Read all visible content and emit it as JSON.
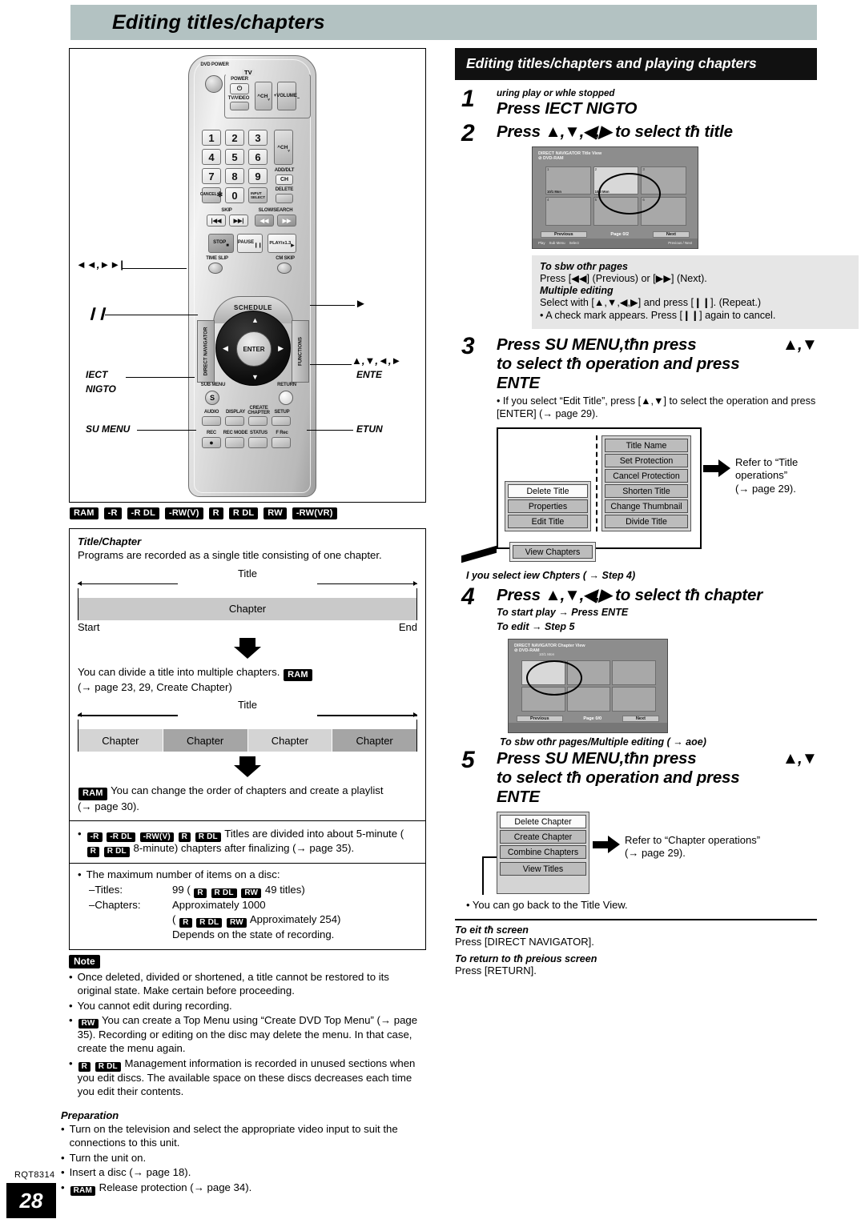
{
  "page_header": {
    "title": "Editing titles/chapters"
  },
  "footer": {
    "rqt": "RQT8314",
    "page_number": "28"
  },
  "left": {
    "remote": {
      "labels": {
        "dvd_power": "DVD POWER",
        "tv_group": "TV",
        "tv_power": "POWER",
        "tv_video": "TV/VIDEO",
        "ch": "CH",
        "volume": "VOLUME",
        "keys": [
          "1",
          "2",
          "3",
          "4",
          "5",
          "6",
          "7",
          "8",
          "9",
          "0"
        ],
        "cancel": "CANCEL",
        "cancel_glyph": "✻",
        "input_select": "INPUT SELECT",
        "add_dlt": "ADD/DLT",
        "add_dlt_ch": "CH",
        "delete": "DELETE",
        "skip": "SKIP",
        "slow_search": "SLOW/SEARCH",
        "stop": "STOP",
        "pause": "PAUSE",
        "play": "PLAY/x1.3",
        "time_slip": "TIME SLIP",
        "cm_skip": "CM SKIP",
        "schedule": "SCHEDULE",
        "direct_navigator": "DIRECT NAVIGATOR",
        "functions": "FUNCTIONS",
        "enter": "ENTER",
        "sub_menu": "SUB MENU",
        "sub_menu_glyph": "S",
        "return": "RETURN",
        "audio": "AUDIO",
        "display": "DISPLAY",
        "create_chapter": "CREATE CHAPTER",
        "setup": "SETUP",
        "rec": "REC",
        "rec_mode": "REC MODE",
        "status": "STATUS",
        "f_rec": "F Rec"
      },
      "callouts": {
        "skip_keys": "◄◄,►►|",
        "pause_key": "❙❙",
        "direct_nav_1": "IECT",
        "direct_nav_2": "NIGTO",
        "sub_menu": "SU MENU",
        "play_key": "►",
        "cursor_keys": "▲,▼,◄,►",
        "enter": "ENTE",
        "return": "ETUN"
      }
    },
    "disc_badges": [
      "RAM",
      "-R",
      "-R DL",
      "-RW(V)",
      "R",
      "R DL",
      "RW",
      "-RW(VR)"
    ],
    "title_chapter": {
      "heading": "Title/Chapter",
      "intro": "Programs are recorded as a single title consisting of one chapter.",
      "diagram1": {
        "title_label": "Title",
        "chapters": [
          "Chapter"
        ],
        "start": "Start",
        "end": "End"
      },
      "divide_text": "You can divide a title into multiple chapters.",
      "divide_badge": "RAM",
      "divide_ref": "(→ page 23, 29, Create Chapter)",
      "diagram2": {
        "title_label": "Title",
        "chapters": [
          "Chapter",
          "Chapter",
          "Chapter",
          "Chapter"
        ]
      },
      "playlist_badge": "RAM",
      "playlist_text": "You can change the order of chapters and create a playlist",
      "playlist_ref": "(→ page 30).",
      "finalize": {
        "badges": [
          "-R",
          "-R DL",
          "-RW(V)",
          "R",
          "R DL"
        ],
        "text_a": "Titles are divided into about 5-minute (",
        "badges_b": [
          "R",
          "R DL"
        ],
        "text_b": "8-minute) chapters after finalizing (→ page 35)."
      },
      "max_items": {
        "lead": "The maximum number of items on a disc:",
        "titles_key": "–Titles:",
        "titles_value_pre": "99 (",
        "titles_badges": [
          "R",
          "R DL",
          "RW"
        ],
        "titles_value_post": "49 titles)",
        "chapters_key": "–Chapters:",
        "chapters_value": "Approximately 1000",
        "chapters_badges": [
          "R",
          "R DL",
          "RW"
        ],
        "chapters_value2_pre": "(",
        "chapters_value2_post": "Approximately 254)",
        "depends": "Depends on the state of recording."
      }
    },
    "note": {
      "tag": "Note",
      "items": [
        {
          "badges": [],
          "text": "Once deleted, divided or shortened, a title cannot be restored to its original state. Make certain before proceeding."
        },
        {
          "badges": [],
          "text": "You cannot edit during recording."
        },
        {
          "badges": [
            "RW"
          ],
          "text": "You can create a Top Menu using “Create DVD Top Menu” (→ page 35). Recording or editing on the disc may delete the menu. In that case, create the menu again."
        },
        {
          "badges": [
            "R",
            "R DL"
          ],
          "text": "Management information is recorded in unused sections when you edit discs. The available space on these discs decreases each time you edit their contents."
        }
      ]
    },
    "preparation": {
      "heading": "Preparation",
      "items": [
        {
          "badges": [],
          "text": "Turn on the television and select the appropriate video input to suit the connections to this unit."
        },
        {
          "badges": [],
          "text": "Turn the unit on."
        },
        {
          "badges": [],
          "text": "Insert a disc (→ page 18)."
        },
        {
          "badges": [
            "RAM"
          ],
          "text": "Release protection (→ page 34)."
        }
      ]
    }
  },
  "right": {
    "banner": "Editing titles/chapters and playing chapters",
    "steps": [
      {
        "num": "1",
        "pre": "uring play or whle stopped",
        "headline": "Press IECT NIGTO"
      },
      {
        "num": "2",
        "headline_pre": "Press",
        "keys": "▲,▼,◀,▶",
        "headline_post": "to select tħ title"
      },
      {
        "num": "3",
        "headline_l1_a": "Press SU MENU,tħn press",
        "headline_l1_keys": "▲,▼",
        "headline_l2": "to select tħ operation and press",
        "headline_l3": "ENTE",
        "note": "If you select “Edit Title”, press [▲,▼] to select the operation and press [ENTER] (→ page 29)."
      },
      {
        "num": "4",
        "headline_pre": "Press",
        "keys": "▲,▼,◀,▶",
        "headline_post": "to select tħ chapter",
        "sub1": "To start play → Press ENTE",
        "sub2": "To edit → Step 5"
      },
      {
        "num": "5",
        "headline_l1_a": "Press SU MENU,tħn press",
        "headline_l1_keys": "▲,▼",
        "headline_l2": "to select tħ operation and press",
        "headline_l3": "ENTE"
      }
    ],
    "title_view_screen": {
      "header_line1": "DIRECT NAVIGATOR Title View",
      "header_line2": "DVD-RAM",
      "thumbs": [
        {
          "n": "1",
          "cap": "10/1 Mon",
          "cap2": "1CH 10:00"
        },
        {
          "n": "2",
          "cap": "10/3 Mon",
          "active": true
        },
        {
          "n": "3",
          "cap": ""
        },
        {
          "n": "4",
          "cap": ""
        },
        {
          "n": "5",
          "cap": ""
        },
        {
          "n": "6",
          "cap": ""
        }
      ],
      "previous": "Previous",
      "page_label": "Page",
      "page_value": "0/2",
      "next": "Next",
      "foot_play": "Play",
      "foot_submenu": "Sub Menu",
      "foot_select": "Select",
      "foot_prevnext": "Previous / Next"
    },
    "chapter_view_screen": {
      "header_line1": "DIRECT NAVIGATOR Chapter View",
      "header_line2": "DVD-RAM",
      "title_caption": "10/1 Mon",
      "previous": "Previous",
      "page_label": "Page",
      "page_value": "0/0",
      "next": "Next"
    },
    "pages_panel": {
      "h1": "To sbw otħr pages",
      "l1": "Press [◀◀] (Previous) or [▶▶] (Next).",
      "h2": "Multiple editing",
      "l2": "Select with [▲,▼,◀,▶] and press [❙❙]. (Repeat.)",
      "l3": "• A check mark appears. Press [❙❙] again to cancel."
    },
    "title_menu": {
      "left_items": [
        "Delete Title",
        "Properties",
        "Edit Title"
      ],
      "view_chapters": "View Chapters",
      "right_items": [
        "Title Name",
        "Set Protection",
        "Cancel Protection",
        "Shorten Title",
        "Change Thumbnail",
        "Divide Title"
      ],
      "refer_l1": "Refer to “Title",
      "refer_l2": "operations”",
      "refer_l3": "(→ page 29)."
    },
    "view_chapters_note": "I you select iew Cħpters (   → Step 4)",
    "multiple_editing_note": "To sbw otħr pages/Multiple editing (   → aoe)",
    "chapter_menu": {
      "items": [
        "Delete Chapter",
        "Create Chapter",
        "Combine Chapters"
      ],
      "view_titles": "View Titles",
      "refer_l1": "Refer to “Chapter operations”",
      "refer_l2": "(→ page 29)."
    },
    "back_note": "• You can go back to the Title View.",
    "exit": {
      "h1": "To eit tħ screen",
      "l1": "Press [DIRECT NAVIGATOR].",
      "h2": "To return to tħ preious screen",
      "l2": "Press [RETURN]."
    }
  }
}
